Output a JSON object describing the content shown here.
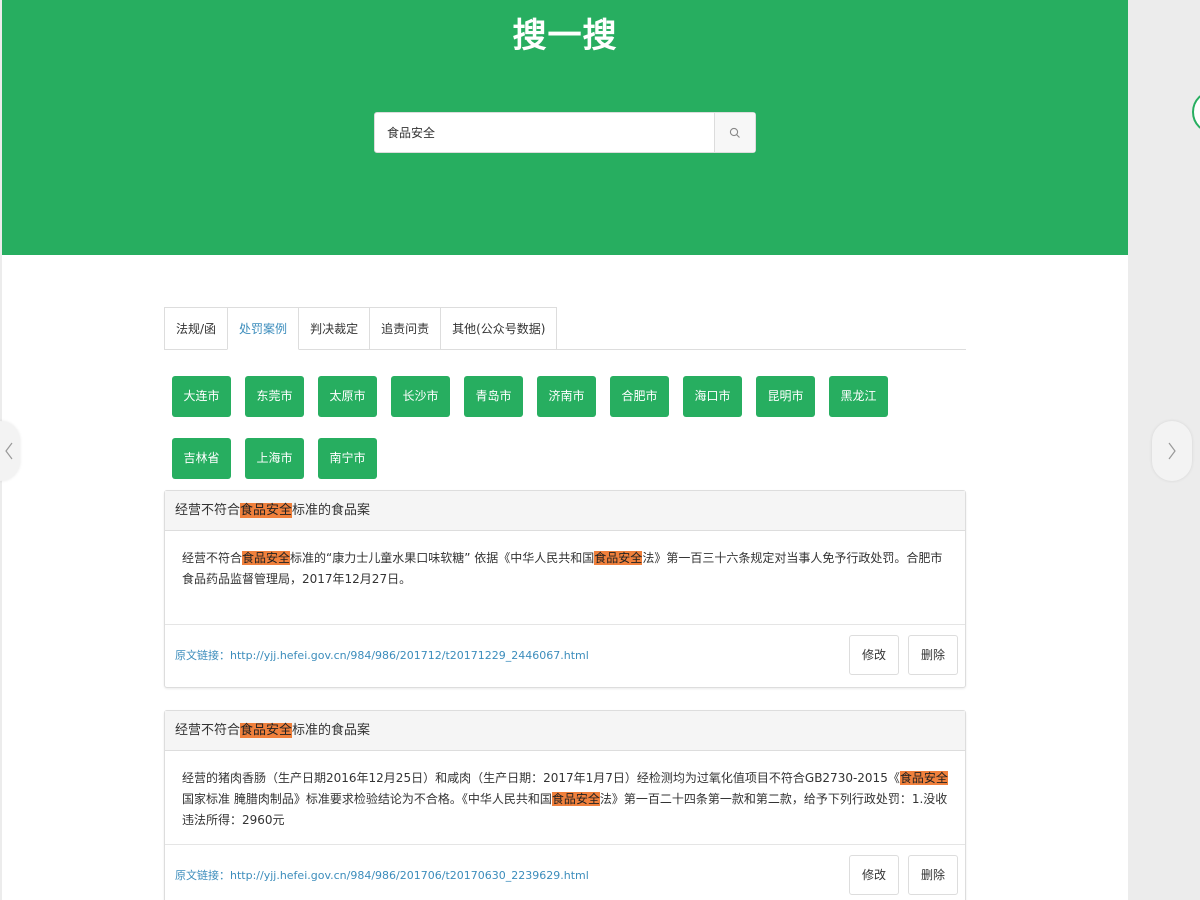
{
  "header": {
    "title": "搜一搜"
  },
  "search": {
    "value": "食品安全",
    "icon": "search-icon"
  },
  "tabs": [
    {
      "label": "法规/函",
      "active": false
    },
    {
      "label": "处罚案例",
      "active": true
    },
    {
      "label": "判决裁定",
      "active": false
    },
    {
      "label": "追责问责",
      "active": false
    },
    {
      "label": "其他(公众号数据)",
      "active": false
    }
  ],
  "cities": [
    "大连市",
    "东莞市",
    "太原市",
    "长沙市",
    "青岛市",
    "济南市",
    "合肥市",
    "海口市",
    "昆明市",
    "黑龙江",
    "吉林省",
    "上海市",
    "南宁市"
  ],
  "highlight_term": "食品安全",
  "cases": [
    {
      "title_before": "经营不符合",
      "title_hl": "食品安全",
      "title_after": "标准的食品案",
      "body_parts": [
        "经营不符合",
        "食品安全",
        "标准的“康力士儿童水果口味软糖” 依据《中华人民共和国",
        "食品安全",
        "法》第一百三十六条规定对当事人免予行政处罚。合肥市食品药品监督管理局，2017年12月27日。"
      ],
      "source_label": "原文链接：",
      "source_url": "http://yjj.hefei.gov.cn/984/986/201712/t20171229_2446067.html",
      "edit_label": "修改",
      "delete_label": "删除"
    },
    {
      "title_before": "经营不符合",
      "title_hl": "食品安全",
      "title_after": "标准的食品案",
      "body_parts": [
        "经营的猪肉香肠（生产日期2016年12月25日）和咸肉（生产日期：2017年1月7日）经检测均为过氧化值项目不符合GB2730-2015《",
        "食品安全",
        "国家标准 腌腊肉制品》标准要求检验结论为不合格。《中华人民共和国",
        "食品安全",
        "法》第一百二十四条第一款和第二款，给予下列行政处罚：1.没收违法所得：2960元"
      ],
      "source_label": "原文链接：",
      "source_url": "http://yjj.hefei.gov.cn/984/986/201706/t20170630_2239629.html",
      "edit_label": "修改",
      "delete_label": "删除"
    }
  ],
  "colors": {
    "primary": "#27ae60",
    "highlight": "#f0803c",
    "link": "#3c8dbc"
  }
}
